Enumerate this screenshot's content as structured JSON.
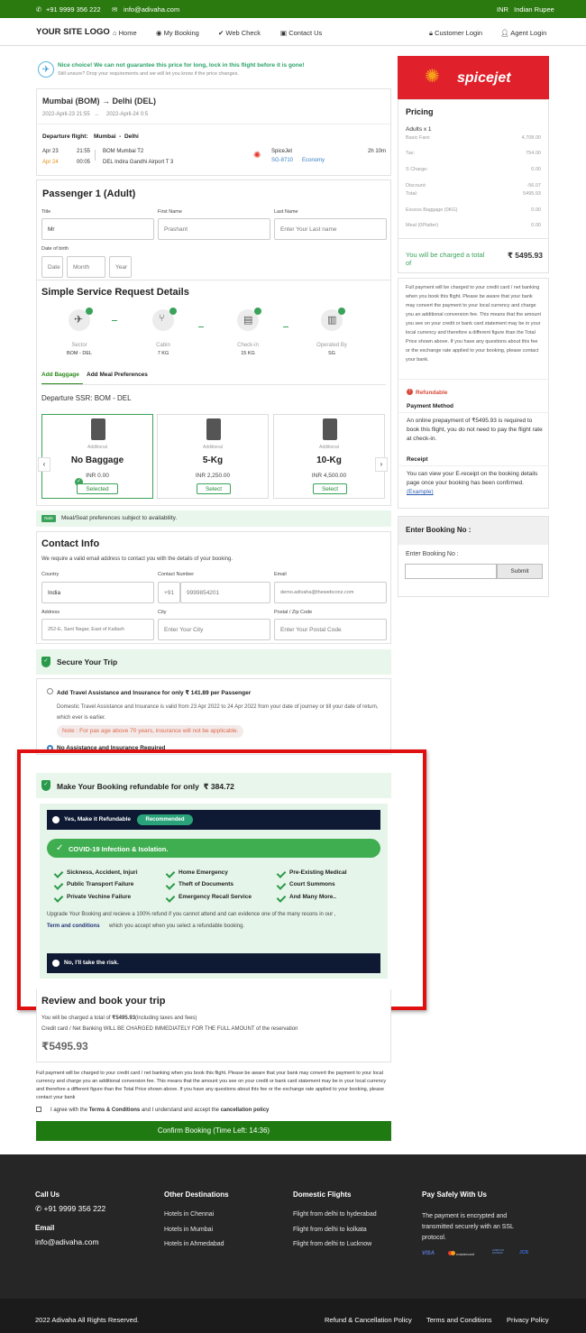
{
  "topbar": {
    "phone": "+91 9999 356 222",
    "email": "info@adivaha.com",
    "currency": "INR   Indian Rupee"
  },
  "nav": {
    "logo": "YOUR SITE LOGO",
    "home": "Home",
    "my_booking": "My Booking",
    "web_check": "Web Check",
    "contact_us": "Contact Us",
    "customer_login": "Customer Login",
    "agent_login": "Agent Login"
  },
  "alert": {
    "title": "Nice choice! We can not guarantee this price for long, lock in this flight before it is gone!",
    "subtitle": "Still unsure? Drop your requirements and we will let you know if the price changes."
  },
  "flight": {
    "route": "Mumbai (BOM) → Delhi (DEL)",
    "dep_time": "2022-April-23 21:55",
    "arrow": "→",
    "arr_time": "2022-April-24 0:5",
    "dep_label": "Departure flight:",
    "dep_route": "Mumbai  -  Delhi",
    "date1": "Apr 23",
    "time1": "21:55",
    "place1": "BOM Mumbai T2",
    "date2": "Apr 24",
    "time2": "00:05",
    "place2": "DEL Indira Gandhi Airport T 3",
    "airline": "SpiceJet",
    "flight_no": "SG-8710",
    "class": "Economy",
    "duration": "2h 10m"
  },
  "passenger": {
    "heading": "Passenger 1 (Adult)",
    "title_label": "Title",
    "title_value": "Mr",
    "first_label": "First Name",
    "first_value": "Prashant",
    "last_label": "Last Name",
    "last_placeholder": "Enter Your Last name",
    "dob_label": "Date of birth",
    "date_ph": "Date",
    "month_ph": "Month",
    "year_ph": "Year"
  },
  "ssr": {
    "heading": "Simple Service Request Details",
    "items": [
      {
        "label": "Sector",
        "value": "BOM - DEL"
      },
      {
        "label": "Cabin",
        "value": "7 KG"
      },
      {
        "label": "Check-in",
        "value": "15 KG"
      },
      {
        "label": "Operated By",
        "value": "SG"
      }
    ],
    "tab_baggage": "Add Baggage",
    "tab_meal": "Add Meal Preferences",
    "departure": "Departure SSR: BOM - DEL",
    "bags": [
      {
        "sub": "Additional",
        "name": "No Baggage",
        "price": "INR 0.00",
        "btn": "Selected"
      },
      {
        "sub": "Additional",
        "name": "5-Kg",
        "price": "INR 2,250.00",
        "btn": "Select"
      },
      {
        "sub": "Additional",
        "name": "10-Kg",
        "price": "INR 4,500.00",
        "btn": "Select"
      }
    ],
    "note_badge": "Note",
    "note": "Meal/Seat preferences subject to availability."
  },
  "contact": {
    "heading": "Contact Info",
    "desc": "We require a valid email address to contact you with the details of your booking.",
    "country_label": "Country",
    "country_value": "India",
    "contact_label": "Contact Number",
    "code": "+91",
    "phone": "9999854201",
    "email_label": "Email",
    "email_value": "demo.adivaha@thewebconz.com",
    "address_label": "Address",
    "address_value": "252-E, Sant Nagar, East of Kailash",
    "city_label": "City",
    "city_ph": "Enter Your City",
    "postal_label": "Postal / Zip Code",
    "postal_ph": "Enter Your Postal Code"
  },
  "secure": {
    "heading": "Secure Your Trip",
    "option1": "Add Travel Assistance and Insurance for only ₹ 141.89 per Passenger",
    "desc": "Domestic Travel Assistance and Insurance is valid from 23 Apr 2022 to 24 Apr 2022 from your date of journey or till your date of return, which ever is earlier.",
    "note": "Note : For pax age above 70 years, insurance will not be applicable.",
    "option2": "No Assistance and Insurance Required"
  },
  "refund": {
    "heading": "Make Your Booking refundable for only  ₹ 384.72",
    "yes": "Yes, Make it Refundable",
    "recommended": "Recommended",
    "covid": "COVID-19 Infection & Isolation.",
    "features": [
      "Sickness, Accident, Injuri",
      "Home Emergency",
      "Pre-Existing Medical",
      "Public Transport Failure",
      "Theft of Documents",
      "Court Summons",
      "Private Vechine Failure",
      "Emergency Recall Service",
      "And Many More.."
    ],
    "upgrade": "Upgrade Your Booking and recieve a 100% refund if you cannot attend and can evidence one of the many resons in our ,",
    "terms_link": "Term and conditions",
    "upgrade2": "which you accept when you select a refundable booking.",
    "no": "No, I'll take the risk."
  },
  "review": {
    "heading": "Review and book your trip",
    "charged_prefix": "You will be charged a total of",
    "charged_amount": "₹5495.93",
    "charged_suffix": "(including taxes and fees)",
    "cc_note": "Credit card / Net Banking WILL BE CHARGED IMMEDIATELY FOR THE FULL AMOUNT of the reservation",
    "total": "₹5495.93",
    "disclaimer": "Full payment will be charged to your credit card / net banking when you book this flight. Please be aware that your bank may convert the payment to your local currency and charge you an additional conversion fee. This means that the amount you see on your credit or bank card statement may be in your local currency and therefore a different figure than the Total Price shown above. If you have any questions about this fee or the exchange rate applied to your booking, please contact your bank",
    "agree_prefix": "I agree with the",
    "agree_terms": "Terms & Conditions",
    "agree_mid": "and I understand and accept the",
    "agree_policy": "cancellation policy",
    "confirm": "Confirm Booking (Time Left: 14:36)"
  },
  "sidebar": {
    "airline_logo": "spicejet",
    "pricing": "Pricing",
    "adults": "Adults x 1",
    "rows": [
      {
        "label": "Basic Fare:",
        "value": "4,708.00"
      },
      {
        "label": "Tax:",
        "value": "754.00"
      },
      {
        "label": "S Charge:",
        "value": "0.00"
      },
      {
        "label": "Discount:",
        "value": "-56.07"
      },
      {
        "label": "Total:",
        "value": "5495.93"
      },
      {
        "label": "Excess Baggage (0KG)",
        "value": "0.00"
      },
      {
        "label": "Meal (0Platter)",
        "value": "0.00"
      }
    ],
    "charged_label": "You will be charged a total of",
    "charged_value": "₹ 5495.93",
    "payment_note": "Full payment will be charged to your credit card / net banking when you book this flight. Please be aware that your bank may convert the payment to your local currency and charge you an additional conversion fee. This means that the amount you see on your credit or bank card statement may be in your local currency and therefore a different figure than the Total Price shown above. If you have any questions about this fee or the exchange rate applied to your booking, please contact your bank.",
    "refundable": "Refundable",
    "payment_method": "Payment Method",
    "online_note": "An online prepayment of ₹5495.93 is required to book this flight, you do not need to pay the flight rate at check-in.",
    "receipt": "Receipt",
    "receipt_note": "You can view your E-receipt on the booking details page once your booking has been confirmed.",
    "example": "(Example)",
    "enter_heading": "Enter Booking No :",
    "enter_label": "Enter Booking No :",
    "submit": "Submit"
  },
  "footer": {
    "call_us": "Call Us",
    "phone": "+91 9999 356 222",
    "email_head": "Email",
    "email": "info@adivaha.com",
    "dest_head": "Other Destinations",
    "dest": [
      "Hotels in Chennai",
      "Hotels in Mumbai",
      "Hotels in Ahmedabad"
    ],
    "dom_head": "Domestic Flights",
    "dom": [
      "Flight from delhi to hyderabad",
      "Flight from delhi to kolkata",
      "Flight from delhi to Lucknow"
    ],
    "pay_head": "Pay Safely With Us",
    "pay_text": "The payment is encrypted and transmitted securely with an SSL protocol.",
    "cards": [
      "VISA",
      "mastercard",
      "AMERICAN EXPRESS",
      "JCB"
    ],
    "copyright": "2022 Adivaha All Rights Reserved.",
    "refund_policy": "Refund & Cancellation Policy",
    "terms": "Terms and Conditions",
    "privacy": "Privacy Policy"
  }
}
